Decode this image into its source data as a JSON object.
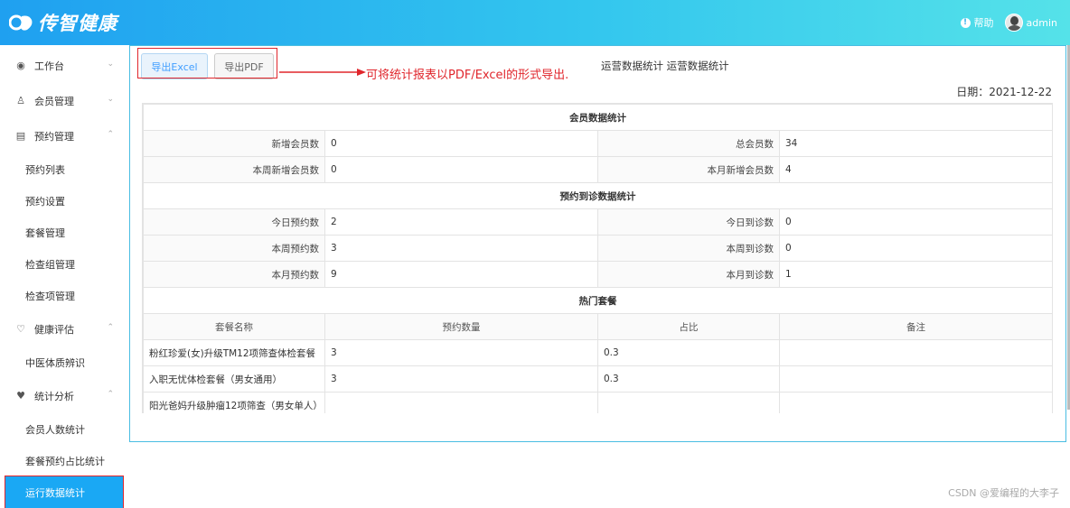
{
  "header": {
    "logo_text": "传智健康",
    "help_label": "帮助",
    "username": "admin"
  },
  "sidebar": {
    "groups": [
      {
        "label": "工作台",
        "icon": "dashboard-icon",
        "expanded": false
      },
      {
        "label": "会员管理",
        "icon": "user-group-icon",
        "expanded": false
      },
      {
        "label": "预约管理",
        "icon": "calendar-icon",
        "expanded": true,
        "items": [
          "预约列表",
          "预约设置",
          "套餐管理",
          "检查组管理",
          "检查项管理"
        ]
      },
      {
        "label": "健康评估",
        "icon": "health-icon",
        "expanded": true,
        "items": [
          "中医体质辨识"
        ]
      },
      {
        "label": "统计分析",
        "icon": "heartbeat-icon",
        "expanded": true,
        "items": [
          "会员人数统计",
          "套餐预约占比统计",
          "运行数据统计"
        ]
      }
    ],
    "active_item": "运行数据统计"
  },
  "toolbar": {
    "export_excel": "导出Excel",
    "export_pdf": "导出PDF",
    "annotation": "可将统计报表以PDF/Excel的形式导出."
  },
  "page": {
    "title": "运营数据统计 运营数据统计",
    "date_label": "日期：",
    "date_value": "2021-12-22"
  },
  "report": {
    "member_section": "会员数据统计",
    "member_rows": [
      {
        "l1": "新增会员数",
        "v1": "0",
        "l2": "总会员数",
        "v2": "34"
      },
      {
        "l1": "本周新增会员数",
        "v1": "0",
        "l2": "本月新增会员数",
        "v2": "4"
      }
    ],
    "visit_section": "预约到诊数据统计",
    "visit_rows": [
      {
        "l1": "今日预约数",
        "v1": "2",
        "l2": "今日到诊数",
        "v2": "0"
      },
      {
        "l1": "本周预约数",
        "v1": "3",
        "l2": "本周到诊数",
        "v2": "0"
      },
      {
        "l1": "本月预约数",
        "v1": "9",
        "l2": "本月到诊数",
        "v2": "1"
      }
    ],
    "hot_section": "热门套餐",
    "hot_headers": [
      "套餐名称",
      "预约数量",
      "占比",
      "备注"
    ],
    "hot_rows": [
      {
        "name": "粉红珍爱(女)升级TM12项筛查体检套餐",
        "count": "3",
        "ratio": "0.3",
        "note": ""
      },
      {
        "name": "入职无忧体检套餐（男女通用）",
        "count": "3",
        "ratio": "0.3",
        "note": ""
      },
      {
        "name": "阳光爸妈升级肿瘤12项筛查（男女单人）",
        "count": "",
        "ratio": "",
        "note": ""
      }
    ]
  },
  "watermark": "CSDN @爱编程的大李子"
}
